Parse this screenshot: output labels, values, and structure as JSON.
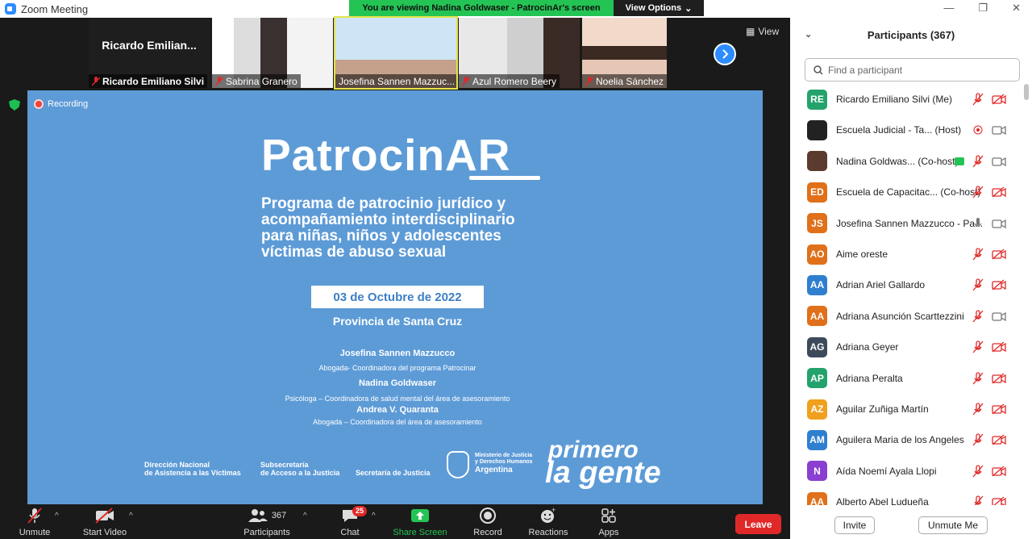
{
  "window": {
    "title": "Zoom Meeting"
  },
  "banner": {
    "text": "You are viewing Nadina Goldwaser - PatrocinAr's screen",
    "view_options": "View Options"
  },
  "gallery": {
    "view_label": "View",
    "tiles": [
      {
        "name": "Ricardo Emiliano Silvi",
        "preview": "Ricardo  Emilian..."
      },
      {
        "name": "Sabrina Granero"
      },
      {
        "name": "Josefina Sannen Mazzuc..."
      },
      {
        "name": "Azul Romero Beery"
      },
      {
        "name": "Noelia Sánchez"
      }
    ]
  },
  "recording": "Recording",
  "slide": {
    "logo": "PatrocinAR",
    "description": [
      "Programa de patrocinio jurídico y",
      "acompañamiento interdisciplinario",
      "para niñas, niños y adolescentes",
      "víctimas de abuso sexual"
    ],
    "date": "03 de Octubre de 2022",
    "province": "Provincia de Santa Cruz",
    "people": [
      {
        "name": "Josefina Sannen Mazzucco",
        "role": "Abogada- Coordinadora del programa Patrocinar"
      },
      {
        "name": "Nadina Goldwaser",
        "role": "Psicóloga – Coordinadora  de salud mental del área de asesoramiento"
      },
      {
        "name": "Andrea V. Quaranta",
        "role": "Abogada – Coordinadora del área de asesoramiento"
      }
    ],
    "footer": {
      "inst1a": "Dirección Nacional",
      "inst1b": "de Asistencia a las Víctimas",
      "inst2a": "Subsecretaría",
      "inst2b": "de Acceso a la Justicia",
      "inst3": "Secretaría de Justicia",
      "ministry1": "Ministerio de Justicia",
      "ministry2": "y Derechos Humanos",
      "country": "Argentina",
      "brand1": "primero",
      "brand2": "la gente"
    }
  },
  "toolbar": {
    "unmute": "Unmute",
    "start_video": "Start Video",
    "participants": "Participants",
    "participants_count": "367",
    "chat": "Chat",
    "chat_badge": "25",
    "share": "Share Screen",
    "record": "Record",
    "reactions": "Reactions",
    "apps": "Apps",
    "leave": "Leave"
  },
  "panel": {
    "title": "Participants (367)",
    "search_placeholder": "Find a participant",
    "invite": "Invite",
    "unmute_me": "Unmute Me",
    "participants": [
      {
        "initials": "RE",
        "color": "#23a36b",
        "name": "Ricardo Emiliano Silvi (Me)",
        "mic": "muted",
        "video": "off"
      },
      {
        "initials": "",
        "color": "#222222",
        "name": "Escuela Judicial - Ta...  (Host)",
        "mic": "recording",
        "video": "on"
      },
      {
        "initials": "",
        "color": "#5a3b2e",
        "name": "Nadina Goldwas...  (Co-host)",
        "mic": "muted",
        "video": "on",
        "share": true
      },
      {
        "initials": "ED",
        "color": "#e0701a",
        "name": "Escuela de Capacitac...  (Co-host)",
        "mic": "muted",
        "video": "off"
      },
      {
        "initials": "JS",
        "color": "#e0701a",
        "name": "Josefina Sannen Mazzucco - Pa...",
        "mic": "on",
        "video": "on"
      },
      {
        "initials": "AO",
        "color": "#e0701a",
        "name": " Aime oreste",
        "mic": "muted",
        "video": "off"
      },
      {
        "initials": "AA",
        "color": "#2f7fd0",
        "name": "Adrian Ariel Gallardo",
        "mic": "muted",
        "video": "off"
      },
      {
        "initials": "AA",
        "color": "#e0701a",
        "name": "Adriana Asunción Scarttezzini",
        "mic": "muted",
        "video": "on"
      },
      {
        "initials": "AG",
        "color": "#3d4a5c",
        "name": "Adriana Geyer",
        "mic": "muted",
        "video": "off"
      },
      {
        "initials": "AP",
        "color": "#23a36b",
        "name": "Adriana Peralta",
        "mic": "muted",
        "video": "off"
      },
      {
        "initials": "AZ",
        "color": "#f0a01e",
        "name": "Aguilar Zuñiga Martín",
        "mic": "muted",
        "video": "off"
      },
      {
        "initials": "AM",
        "color": "#2f7fd0",
        "name": "Aguilera Maria de los Angeles",
        "mic": "muted",
        "video": "off"
      },
      {
        "initials": "N",
        "color": "#8a3fd1",
        "name": "Aída Noemí Ayala Llopi",
        "mic": "muted",
        "video": "off"
      },
      {
        "initials": "AA",
        "color": "#e0701a",
        "name": "Alberto Abel Ludueña",
        "mic": "muted",
        "video": "off"
      }
    ]
  }
}
